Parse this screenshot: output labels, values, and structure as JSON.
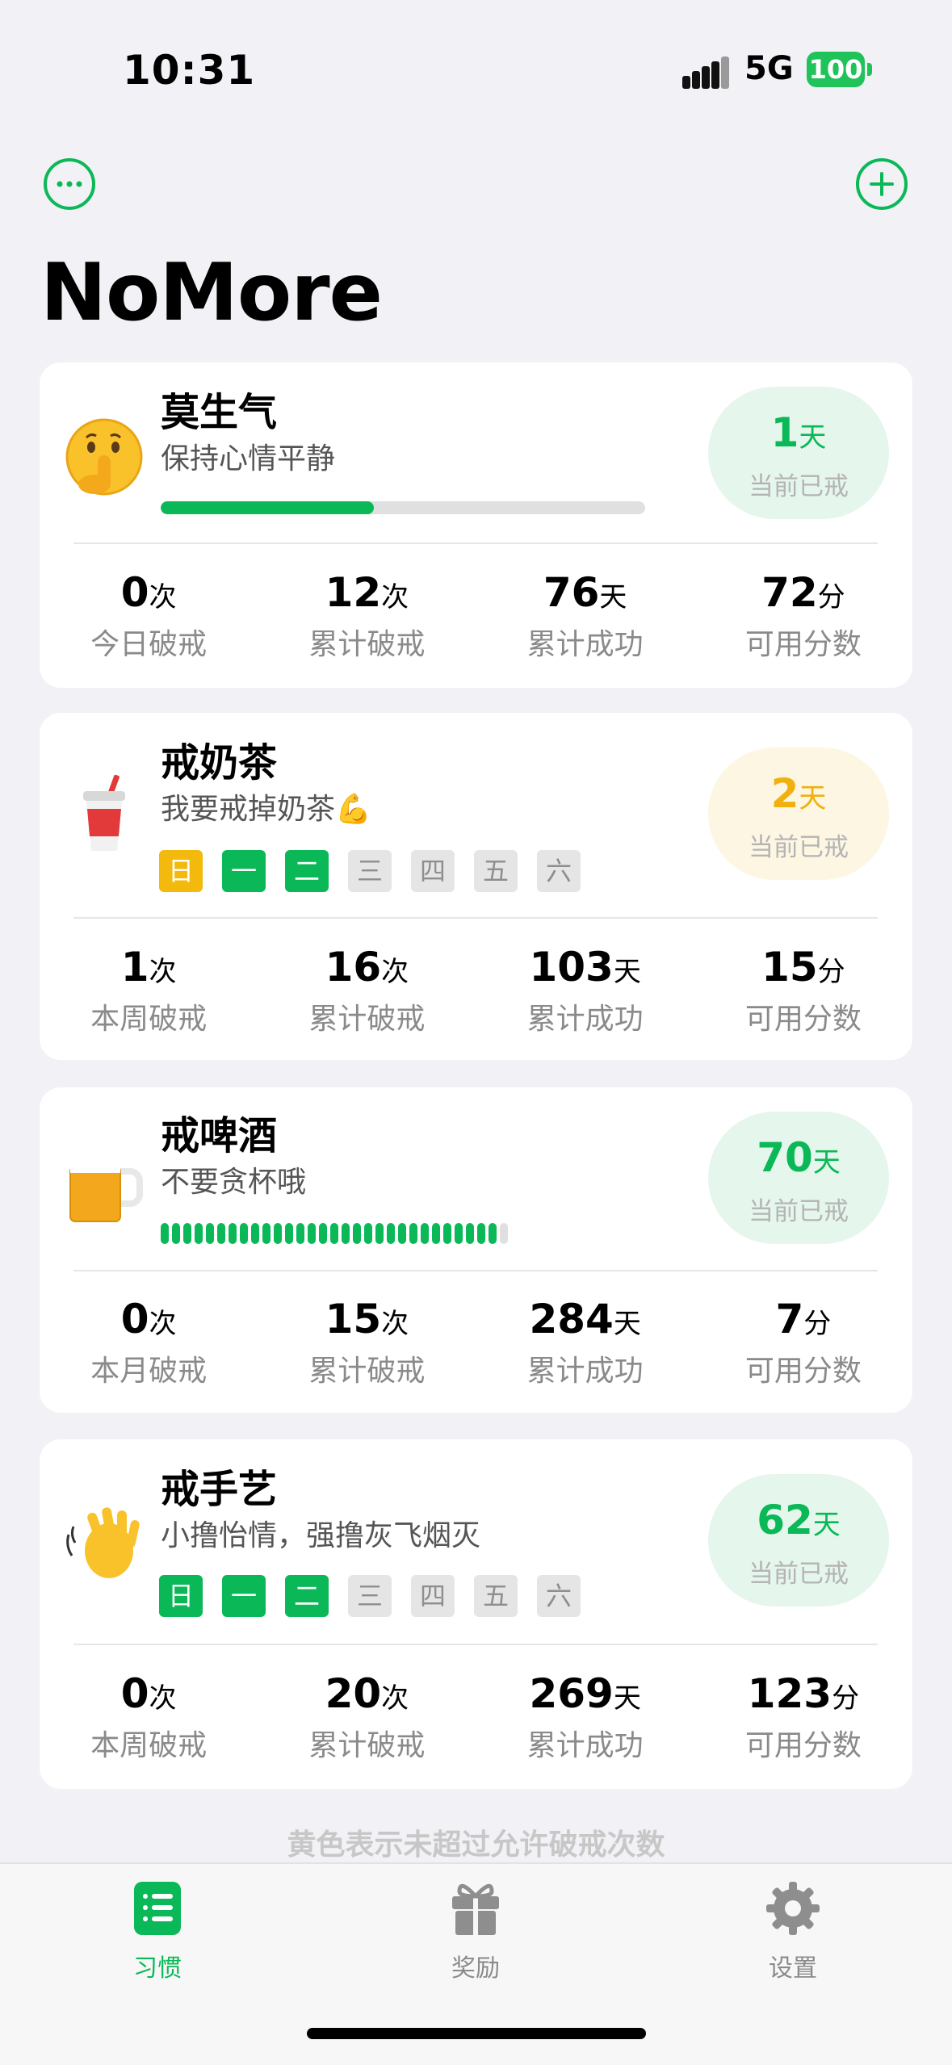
{
  "status_bar": {
    "time": "10:31",
    "network": "5G",
    "battery": "100"
  },
  "header": {
    "title": "NoMore",
    "more_icon": "ellipsis-circle-icon",
    "add_icon": "plus-circle-icon"
  },
  "colors": {
    "accent": "#0bb857",
    "warning": "#f4b90d",
    "background": "#f1f1f6"
  },
  "habits": [
    {
      "emoji": "🤫",
      "name": "莫生气",
      "desc": "保持心情平静",
      "current_days": "1",
      "current_unit": "天",
      "current_label": "当前已戒",
      "pill_color": "green",
      "progress": 0.44,
      "stats": [
        {
          "value": "0",
          "unit": "次",
          "label": "今日破戒"
        },
        {
          "value": "12",
          "unit": "次",
          "label": "累计破戒"
        },
        {
          "value": "76",
          "unit": "天",
          "label": "累计成功"
        },
        {
          "value": "72",
          "unit": "分",
          "label": "可用分数"
        }
      ]
    },
    {
      "emoji": "🥤",
      "name": "戒奶茶",
      "desc": "我要戒掉奶茶💪",
      "current_days": "2",
      "current_unit": "天",
      "current_label": "当前已戒",
      "pill_color": "yellow",
      "weekdays": [
        {
          "label": "日",
          "state": "y"
        },
        {
          "label": "一",
          "state": "g"
        },
        {
          "label": "二",
          "state": "g"
        },
        {
          "label": "三",
          "state": "n"
        },
        {
          "label": "四",
          "state": "n"
        },
        {
          "label": "五",
          "state": "n"
        },
        {
          "label": "六",
          "state": "n"
        }
      ],
      "stats": [
        {
          "value": "1",
          "unit": "次",
          "label": "本周破戒"
        },
        {
          "value": "16",
          "unit": "次",
          "label": "累计破戒"
        },
        {
          "value": "103",
          "unit": "天",
          "label": "累计成功"
        },
        {
          "value": "15",
          "unit": "分",
          "label": "可用分数"
        }
      ]
    },
    {
      "emoji": "🍺",
      "name": "戒啤酒",
      "desc": "不要贪杯哦",
      "current_days": "70",
      "current_unit": "天",
      "current_label": "当前已戒",
      "pill_color": "green",
      "month_segments": {
        "done": 30,
        "total": 31
      },
      "stats": [
        {
          "value": "0",
          "unit": "次",
          "label": "本月破戒"
        },
        {
          "value": "15",
          "unit": "次",
          "label": "累计破戒"
        },
        {
          "value": "284",
          "unit": "天",
          "label": "累计成功"
        },
        {
          "value": "7",
          "unit": "分",
          "label": "可用分数"
        }
      ]
    },
    {
      "emoji": "👋",
      "name": "戒手艺",
      "desc": "小撸怡情，强撸灰飞烟灭",
      "current_days": "62",
      "current_unit": "天",
      "current_label": "当前已戒",
      "pill_color": "green",
      "weekdays": [
        {
          "label": "日",
          "state": "g"
        },
        {
          "label": "一",
          "state": "g"
        },
        {
          "label": "二",
          "state": "g"
        },
        {
          "label": "三",
          "state": "n"
        },
        {
          "label": "四",
          "state": "n"
        },
        {
          "label": "五",
          "state": "n"
        },
        {
          "label": "六",
          "state": "n"
        }
      ],
      "stats": [
        {
          "value": "0",
          "unit": "次",
          "label": "本周破戒"
        },
        {
          "value": "20",
          "unit": "次",
          "label": "累计破戒"
        },
        {
          "value": "269",
          "unit": "天",
          "label": "累计成功"
        },
        {
          "value": "123",
          "unit": "分",
          "label": "可用分数"
        }
      ]
    }
  ],
  "hint": "黄色表示未超过允许破戒次数",
  "tabs": [
    {
      "label": "习惯",
      "icon": "habits-list-icon",
      "active": true
    },
    {
      "label": "奖励",
      "icon": "gift-icon",
      "active": false
    },
    {
      "label": "设置",
      "icon": "gear-icon",
      "active": false
    }
  ]
}
